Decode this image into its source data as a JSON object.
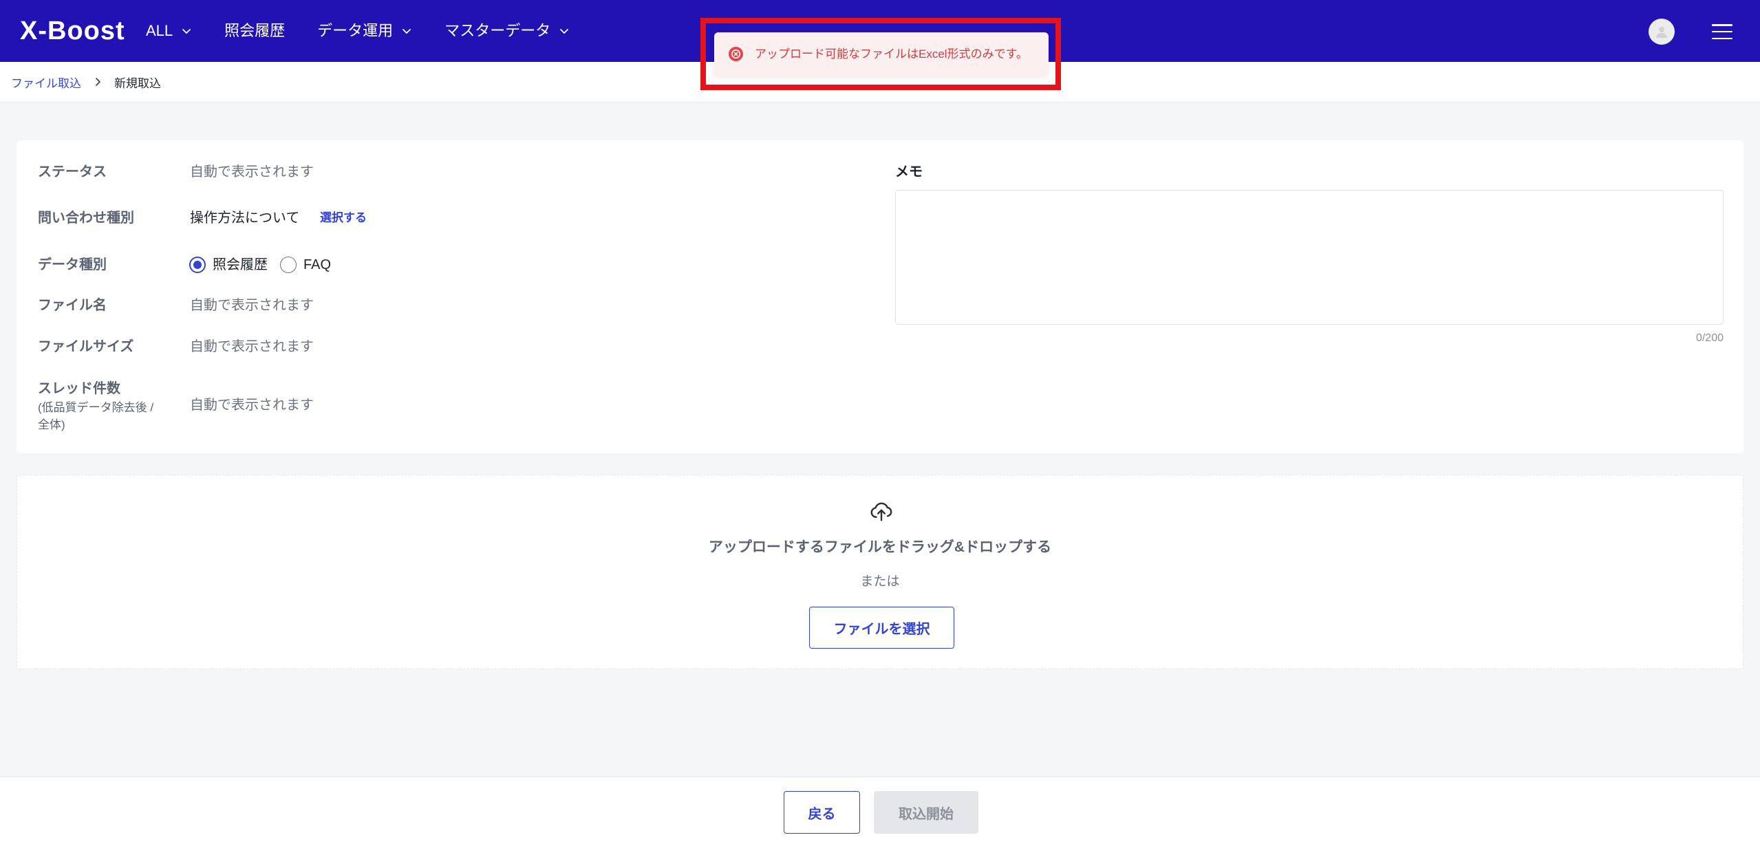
{
  "colors": {
    "header_bg": "#2212b3",
    "accent": "#3344d4",
    "error_text": "#d23d3d",
    "error_bg": "#fcefef",
    "highlight_border": "#e3121b",
    "page_bg": "#f5f6f8",
    "disabled_bg": "#e4e6ea"
  },
  "header": {
    "logo": "X-Boost",
    "nav": [
      {
        "label": "ALL",
        "icon": "chevron-down-icon"
      },
      {
        "label": "照会履歴"
      },
      {
        "label": "データ運用",
        "icon": "chevron-down-icon"
      },
      {
        "label": "マスターデータ",
        "icon": "chevron-down-icon"
      }
    ],
    "avatar_icon": "user-avatar-icon",
    "menu_icon": "hamburger-menu-icon"
  },
  "toast": {
    "icon": "error-circle-icon",
    "message": "アップロード可能なファイルはExcel形式のみです。"
  },
  "breadcrumb": {
    "items": [
      {
        "label": "ファイル取込"
      },
      {
        "label": "新規取込"
      }
    ],
    "separator_icon": "chevron-right-icon"
  },
  "form": {
    "status": {
      "label": "ステータス",
      "value": "自動で表示されます"
    },
    "inquiry_type": {
      "label": "問い合わせ種別",
      "value": "操作方法について",
      "action_label": "選択する"
    },
    "data_type": {
      "label": "データ種別",
      "options": [
        {
          "label": "照会履歴",
          "selected": true
        },
        {
          "label": "FAQ",
          "selected": false
        }
      ]
    },
    "file_name": {
      "label": "ファイル名",
      "value": "自動で表示されます"
    },
    "file_size": {
      "label": "ファイルサイズ",
      "value": "自動で表示されます"
    },
    "thread_count": {
      "label": "スレッド件数",
      "sublabel": "(低品質データ除去後 /\n全体)",
      "value": "自動で表示されます"
    },
    "memo": {
      "label": "メモ",
      "value": "",
      "counter": "0/200"
    }
  },
  "upload": {
    "icon": "cloud-upload-icon",
    "drop_text": "アップロードするファイルをドラッグ&ドロップする",
    "or_text": "または",
    "select_button": "ファイルを選択"
  },
  "footer": {
    "back_button": "戻る",
    "submit_button": "取込開始",
    "submit_disabled": true
  }
}
